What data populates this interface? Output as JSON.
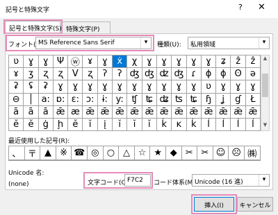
{
  "window": {
    "title": "記号と特殊文字",
    "help": "?",
    "close": "✕"
  },
  "tabs": [
    {
      "label": "記号と特殊文字(S)",
      "active": true
    },
    {
      "label": "特殊文字(P)",
      "active": false
    }
  ],
  "font": {
    "label": "フォント(F):",
    "value": "MS Reference Sans Serif"
  },
  "subset": {
    "label": "種類(U):",
    "value": "私用領域"
  },
  "grid": {
    "rows": [
      [
        "ʋ",
        "ɣ",
        "ɣ",
        "Ψ",
        "ⓦ",
        "ɤ",
        "ɣ",
        "ẋ",
        "χ",
        "ɣ",
        "ɣ",
        "ɣ",
        "ɣ",
        "ɣ",
        "ʑ",
        "ẑ",
        "ẑ"
      ],
      [
        "ɤ",
        "ʒ",
        "ʐ",
        "ʐ",
        "V",
        "ʐ",
        "ʔ",
        "ʔ",
        "ʤ",
        "ʤ",
        "ʣ",
        "ʤ",
        "ɾ",
        "ɸ",
        "ɸ",
        "ʘ",
        "ǝ"
      ],
      [
        "ʡ",
        "ʢ",
        "ʡ",
        "ɣ",
        "ɣ",
        "ɣ",
        "ɣ",
        "ɣ",
        "ɣ",
        "ɣ",
        "ɣ",
        "ɣ",
        "ɣ",
        "ʋ",
        "ɣ",
        "ɣ",
        "ɣ"
      ],
      [
        "⊖",
        "│",
        "a:",
        "ɒ:",
        "ɛ:",
        "ɔ:",
        "ɨ:",
        "y:",
        "ʧ",
        "ʨ",
        "ʥ",
        "ʦ",
        "ʨ",
        "ɧ",
        "ʝ",
        "ɠ",
        "Ł"
      ],
      [
        "ā",
        "ā",
        "ā",
        "ǣ",
        "æ",
        "ǣ",
        "ǣ",
        "ǣ",
        "ǣ",
        "ǣ",
        "ǣ",
        "ǣ",
        "ǣ",
        "ǣ",
        "ǣ",
        "ǣ",
        "ǣ"
      ],
      [
        "ĕ",
        "ĕ",
        "ġ",
        "ḩ",
        "ĕ",
        "ĭ",
        "į",
        "ĭ",
        "ĭ",
        "ĭ",
        "ḱ",
        "ĸ",
        "ḱ",
        "ĺ",
        "ĺ",
        "ĺ",
        "ĺ"
      ]
    ]
  },
  "recent": {
    "label": "最近使用した記号(R):",
    "symbols": [
      "、",
      "〒",
      "▲",
      "※",
      "☎",
      "◎",
      "○",
      "△",
      "☆",
      "★",
      "◆",
      "✂",
      "✂",
      "☺",
      "☹",
      "㈱"
    ]
  },
  "unicode": {
    "label": "Unicode 名:",
    "value": "(none)"
  },
  "charcode": {
    "label": "文字コード(C):",
    "value": "F7C2"
  },
  "codesystem": {
    "label": "コード体系(M):",
    "value": "Unicode (16 進)"
  },
  "buttons": {
    "insert": "挿入(I)",
    "cancel": "キャンセル"
  },
  "colors": {
    "highlight": "#e58bb8",
    "selection": "#0078d7"
  },
  "selected_cell": {
    "row": 0,
    "col": 7
  }
}
